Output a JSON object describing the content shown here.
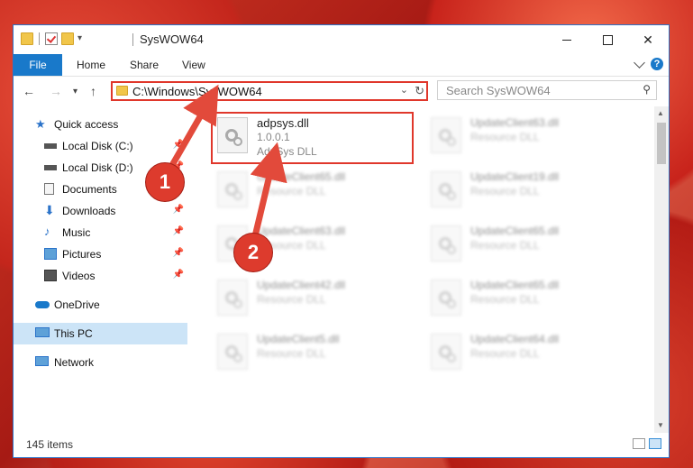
{
  "window": {
    "title": "SysWOW64",
    "controls": {
      "minimize": "minimize",
      "maximize": "maximize",
      "close": "✕"
    }
  },
  "ribbon": {
    "tabs": [
      "File",
      "Home",
      "Share",
      "View"
    ]
  },
  "address": {
    "path": "C:\\Windows\\SysWOW64",
    "search_placeholder": "Search SysWOW64"
  },
  "sidebar": {
    "items": [
      {
        "label": "Quick access",
        "icon": "star-icon"
      },
      {
        "label": "Local Disk (C:)",
        "icon": "drive-icon"
      },
      {
        "label": "Local Disk (D:)",
        "icon": "drive-icon"
      },
      {
        "label": "Documents",
        "icon": "document-icon"
      },
      {
        "label": "Downloads",
        "icon": "download-icon"
      },
      {
        "label": "Music",
        "icon": "music-icon"
      },
      {
        "label": "Pictures",
        "icon": "picture-icon"
      },
      {
        "label": "Videos",
        "icon": "video-icon"
      },
      {
        "label": "OneDrive",
        "icon": "cloud-icon"
      },
      {
        "label": "This PC",
        "icon": "computer-icon"
      },
      {
        "label": "Network",
        "icon": "network-icon"
      }
    ]
  },
  "files": {
    "featured": {
      "name": "adpsys.dll",
      "version": "1.0.0.1",
      "description": "AdpSys DLL"
    },
    "left_column": [
      {
        "name": "UpdateClient65.dll",
        "type": "Resource DLL"
      },
      {
        "name": "UpdateClient63.dll",
        "type": "Resource DLL"
      },
      {
        "name": "UpdateClient42.dll",
        "type": "Resource DLL"
      },
      {
        "name": "UpdateClient5.dll",
        "type": "Resource DLL"
      }
    ],
    "right_column": [
      {
        "name": "UpdateClient63.dll",
        "type": "Resource DLL"
      },
      {
        "name": "UpdateClient19.dll",
        "type": "Resource DLL"
      },
      {
        "name": "UpdateClient65.dll",
        "type": "Resource DLL"
      },
      {
        "name": "UpdateClient65.dll",
        "type": "Resource DLL"
      },
      {
        "name": "UpdateClient64.dll",
        "type": "Resource DLL"
      }
    ]
  },
  "status": {
    "item_count": "145 items"
  },
  "annotations": {
    "marker_1": "1",
    "marker_2": "2",
    "color": "#dd3b2d"
  }
}
